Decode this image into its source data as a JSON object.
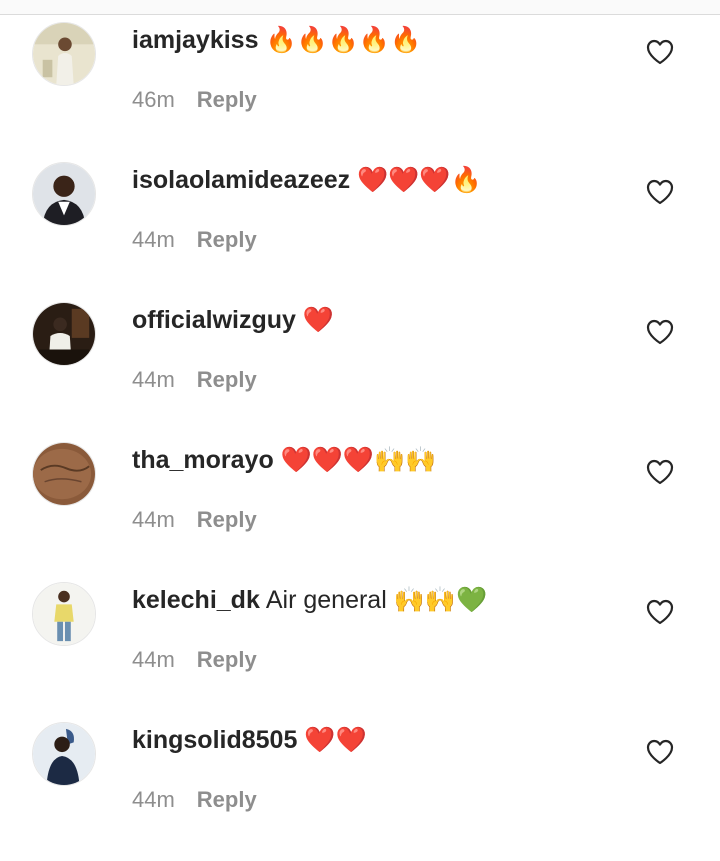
{
  "comments": [
    {
      "username": "iamjaykiss",
      "text": "",
      "emoji": "🔥🔥🔥🔥🔥",
      "time": "46m",
      "reply_label": "Reply",
      "like_icon": "heart-outline-icon"
    },
    {
      "username": "isolaolamideazeez",
      "text": "",
      "emoji": "❤️❤️❤️🔥",
      "time": "44m",
      "reply_label": "Reply",
      "like_icon": "heart-outline-icon"
    },
    {
      "username": "officialwizguy",
      "text": "",
      "emoji": "❤️",
      "time": "44m",
      "reply_label": "Reply",
      "like_icon": "heart-outline-icon"
    },
    {
      "username": "tha_morayo",
      "text": "",
      "emoji": "❤️❤️❤️🙌🙌",
      "time": "44m",
      "reply_label": "Reply",
      "like_icon": "heart-outline-icon"
    },
    {
      "username": "kelechi_dk",
      "text": "Air general",
      "emoji": "🙌🙌💚",
      "time": "44m",
      "reply_label": "Reply",
      "like_icon": "heart-outline-icon"
    },
    {
      "username": "kingsolid8505",
      "text": "",
      "emoji": "❤️❤️",
      "time": "44m",
      "reply_label": "Reply",
      "like_icon": "heart-outline-icon"
    }
  ],
  "colors": {
    "text": "#262626",
    "secondary": "#8e8e8e",
    "divider": "#dbdbdb"
  }
}
